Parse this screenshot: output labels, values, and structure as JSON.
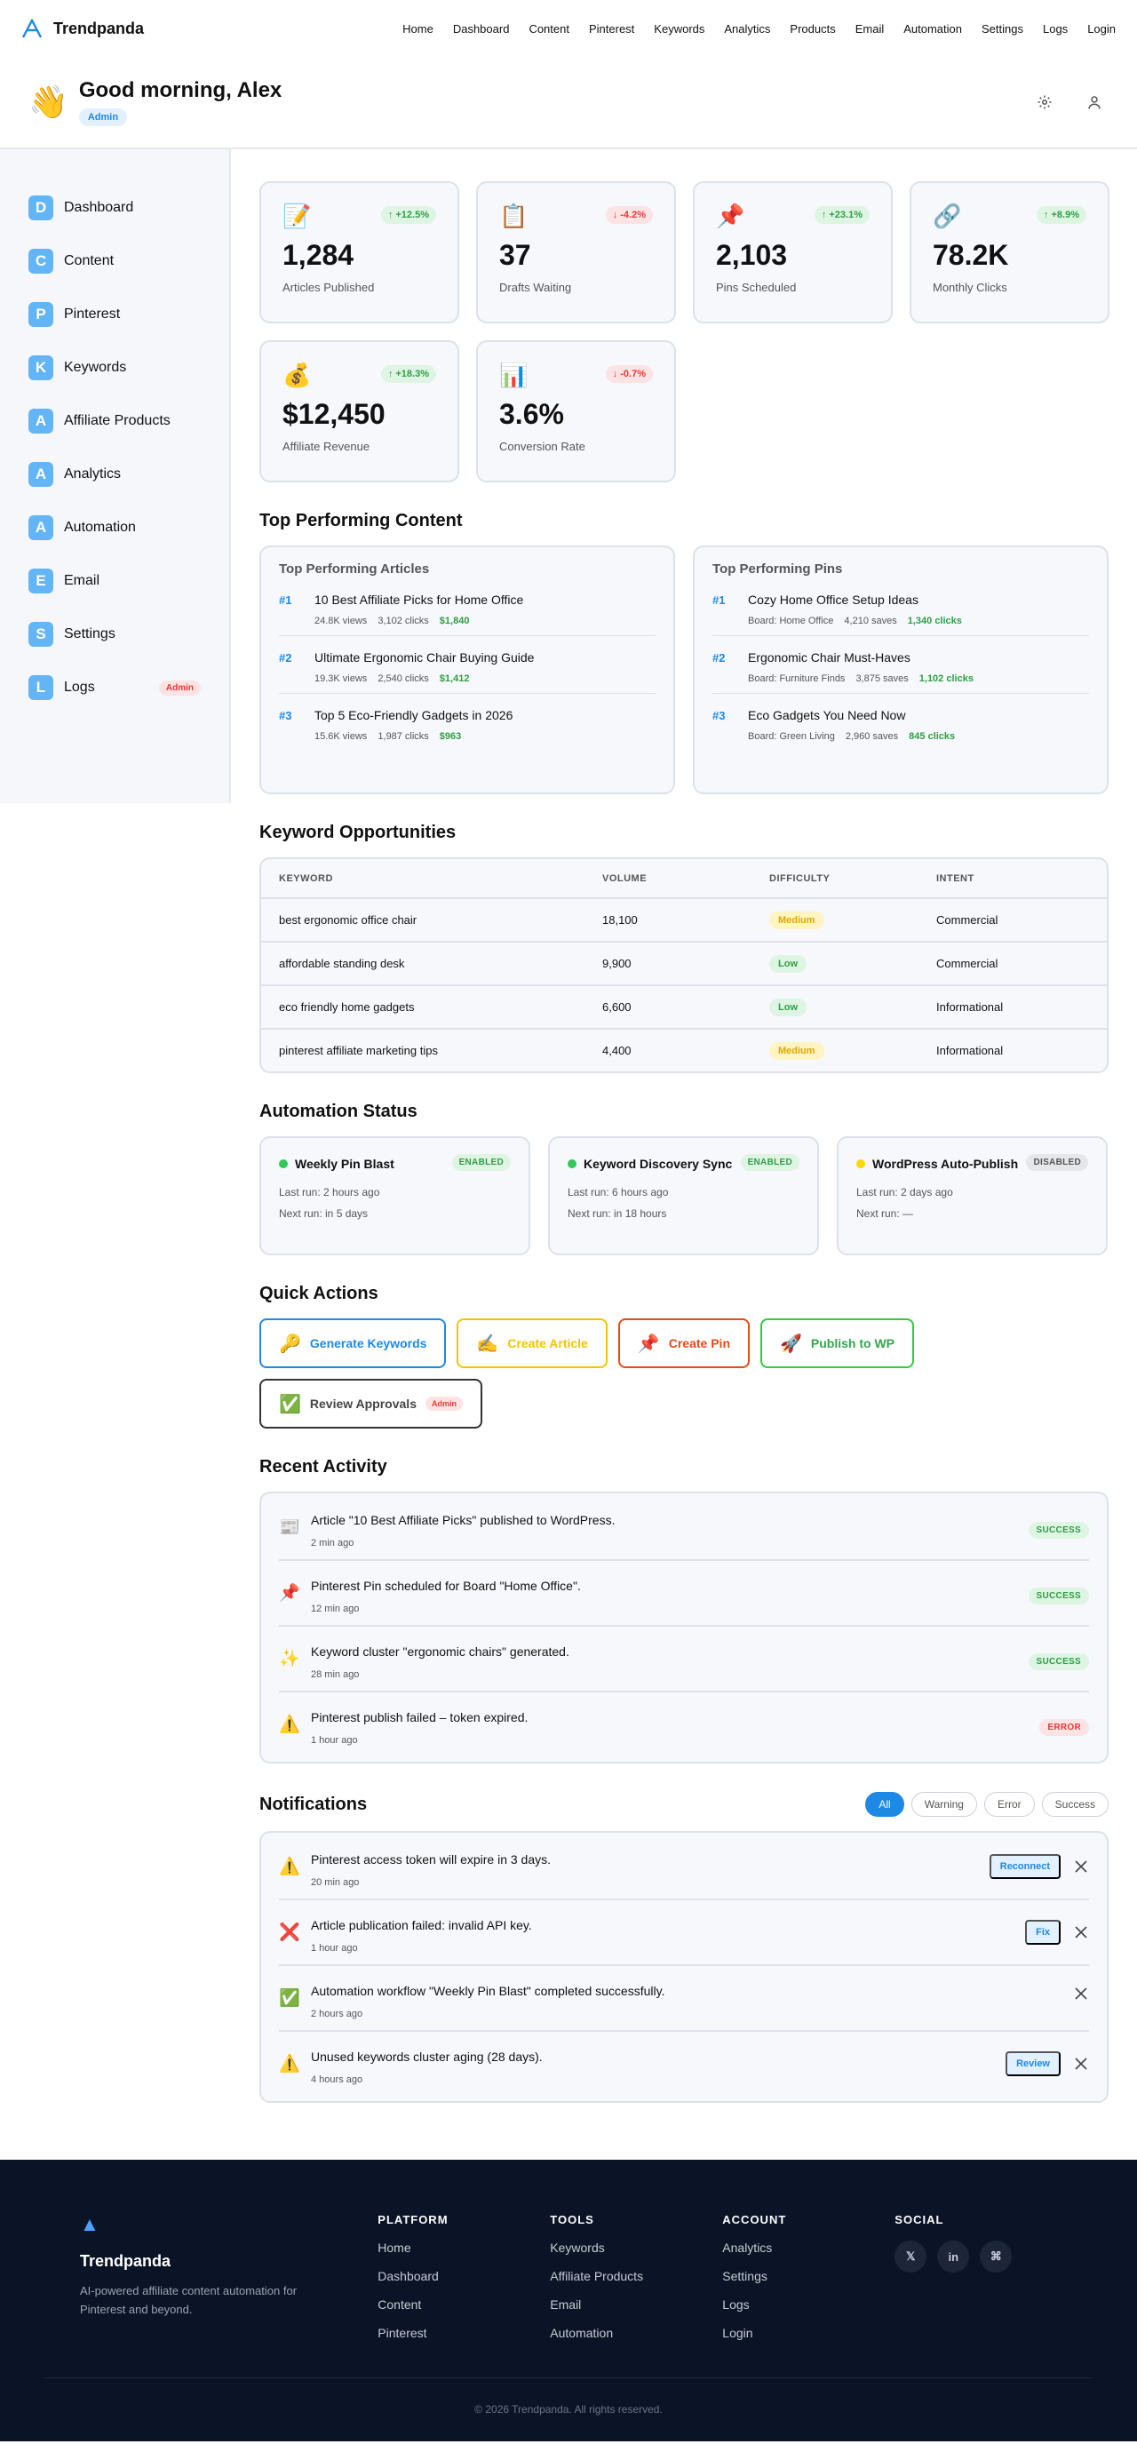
{
  "brand": {
    "name": "Trendpanda",
    "accent": "#1e88e5"
  },
  "nav": [
    "Home",
    "Dashboard",
    "Content",
    "Pinterest",
    "Keywords",
    "Analytics",
    "Products",
    "Email",
    "Automation",
    "Settings",
    "Logs",
    "Login"
  ],
  "greeting": {
    "emoji": "👋",
    "title": "Good morning, Alex",
    "role": "Admin"
  },
  "sidebar": [
    {
      "letter": "D",
      "label": "Dashboard"
    },
    {
      "letter": "C",
      "label": "Content"
    },
    {
      "letter": "P",
      "label": "Pinterest"
    },
    {
      "letter": "K",
      "label": "Keywords"
    },
    {
      "letter": "A",
      "label": "Affiliate Products"
    },
    {
      "letter": "A",
      "label": "Analytics"
    },
    {
      "letter": "A",
      "label": "Automation"
    },
    {
      "letter": "E",
      "label": "Email"
    },
    {
      "letter": "S",
      "label": "Settings"
    },
    {
      "letter": "L",
      "label": "Logs",
      "badge": "Admin"
    }
  ],
  "stats": [
    {
      "icon": "📝",
      "delta": "↑ +12.5%",
      "dir": "up",
      "value": "1,284",
      "label": "Articles Published"
    },
    {
      "icon": "📋",
      "delta": "↓ -4.2%",
      "dir": "down",
      "value": "37",
      "label": "Drafts Waiting"
    },
    {
      "icon": "📌",
      "delta": "↑ +23.1%",
      "dir": "up",
      "value": "2,103",
      "label": "Pins Scheduled"
    },
    {
      "icon": "🔗",
      "delta": "↑ +8.9%",
      "dir": "up",
      "value": "78.2K",
      "label": "Monthly Clicks"
    },
    {
      "icon": "💰",
      "delta": "↑ +18.3%",
      "dir": "up",
      "value": "$12,450",
      "label": "Affiliate Revenue"
    },
    {
      "icon": "📊",
      "delta": "↓ -0.7%",
      "dir": "down",
      "value": "3.6%",
      "label": "Conversion Rate"
    }
  ],
  "top_content": {
    "title": "Top Performing Content",
    "articles": {
      "title": "Top Performing Articles",
      "items": [
        {
          "rank": "#1",
          "title": "10 Best Affiliate Picks for Home Office",
          "m1": "24.8K views",
          "m2": "3,102 clicks",
          "m3": "$1,840"
        },
        {
          "rank": "#2",
          "title": "Ultimate Ergonomic Chair Buying Guide",
          "m1": "19.3K views",
          "m2": "2,540 clicks",
          "m3": "$1,412"
        },
        {
          "rank": "#3",
          "title": "Top 5 Eco-Friendly Gadgets in 2026",
          "m1": "15.6K views",
          "m2": "1,987 clicks",
          "m3": "$963"
        }
      ]
    },
    "pins": {
      "title": "Top Performing Pins",
      "items": [
        {
          "rank": "#1",
          "title": "Cozy Home Office Setup Ideas",
          "m1": "Board: Home Office",
          "m2": "4,210 saves",
          "m3": "1,340 clicks"
        },
        {
          "rank": "#2",
          "title": "Ergonomic Chair Must-Haves",
          "m1": "Board: Furniture Finds",
          "m2": "3,875 saves",
          "m3": "1,102 clicks"
        },
        {
          "rank": "#3",
          "title": "Eco Gadgets You Need Now",
          "m1": "Board: Green Living",
          "m2": "2,960 saves",
          "m3": "845 clicks"
        }
      ]
    }
  },
  "keywords": {
    "title": "Keyword Opportunities",
    "headers": [
      "KEYWORD",
      "VOLUME",
      "DIFFICULTY",
      "INTENT"
    ],
    "rows": [
      {
        "keyword": "best ergonomic office chair",
        "volume": "18,100",
        "difficulty": "Medium",
        "intent": "Commercial"
      },
      {
        "keyword": "affordable standing desk",
        "volume": "9,900",
        "difficulty": "Low",
        "intent": "Commercial"
      },
      {
        "keyword": "eco friendly home gadgets",
        "volume": "6,600",
        "difficulty": "Low",
        "intent": "Informational"
      },
      {
        "keyword": "pinterest affiliate marketing tips",
        "volume": "4,400",
        "difficulty": "Medium",
        "intent": "Informational"
      }
    ]
  },
  "automation": {
    "title": "Automation Status",
    "items": [
      {
        "name": "Weekly Pin Blast",
        "status": "ENABLED",
        "last": "Last run: 2 hours ago",
        "next": "Next run: in 5 days",
        "dot": "green"
      },
      {
        "name": "Keyword Discovery Sync",
        "status": "ENABLED",
        "last": "Last run: 6 hours ago",
        "next": "Next run: in 18 hours",
        "dot": "green"
      },
      {
        "name": "WordPress Auto-Publish",
        "status": "DISABLED",
        "last": "Last run: 2 days ago",
        "next": "Next run: —",
        "dot": "yellow"
      }
    ]
  },
  "quick_actions": {
    "title": "Quick Actions",
    "items": [
      {
        "emoji": "🔑",
        "label": "Generate Keywords",
        "style": "blue"
      },
      {
        "emoji": "✍️",
        "label": "Create Article",
        "style": "yellow"
      },
      {
        "emoji": "📌",
        "label": "Create Pin",
        "style": "red"
      },
      {
        "emoji": "🚀",
        "label": "Publish to WP",
        "style": "green"
      },
      {
        "emoji": "✅",
        "label": "Review Approvals",
        "style": "gray",
        "badge": "Admin"
      }
    ]
  },
  "activity": {
    "title": "Recent Activity",
    "items": [
      {
        "icon": "📰",
        "text": "Article \"10 Best Affiliate Picks\" published to WordPress.",
        "time": "2 min ago",
        "status": "SUCCESS"
      },
      {
        "icon": "📌",
        "text": "Pinterest Pin scheduled for Board \"Home Office\".",
        "time": "12 min ago",
        "status": "SUCCESS"
      },
      {
        "icon": "✨",
        "text": "Keyword cluster \"ergonomic chairs\" generated.",
        "time": "28 min ago",
        "status": "SUCCESS"
      },
      {
        "icon": "⚠️",
        "text": "Pinterest publish failed – token expired.",
        "time": "1 hour ago",
        "status": "ERROR"
      }
    ]
  },
  "notifications": {
    "title": "Notifications",
    "filters": [
      "All",
      "Warning",
      "Error",
      "Success"
    ],
    "items": [
      {
        "icon": "⚠️",
        "text": "Pinterest access token will expire in 3 days.",
        "time": "20 min ago",
        "action": "Reconnect"
      },
      {
        "icon": "❌",
        "text": "Article publication failed: invalid API key.",
        "time": "1 hour ago",
        "action": "Fix"
      },
      {
        "icon": "✅",
        "text": "Automation workflow \"Weekly Pin Blast\" completed successfully.",
        "time": "2 hours ago",
        "action": ""
      },
      {
        "icon": "⚠️",
        "text": "Unused keywords cluster aging (28 days).",
        "time": "4 hours ago",
        "action": "Review"
      }
    ]
  },
  "footer": {
    "logo": "▲",
    "name": "Trendpanda",
    "tagline": "AI-powered affiliate content automation for Pinterest and beyond.",
    "columns": [
      {
        "head": "PLATFORM",
        "links": [
          "Home",
          "Dashboard",
          "Content",
          "Pinterest"
        ]
      },
      {
        "head": "TOOLS",
        "links": [
          "Keywords",
          "Affiliate Products",
          "Email",
          "Automation"
        ]
      },
      {
        "head": "ACCOUNT",
        "links": [
          "Analytics",
          "Settings",
          "Logs",
          "Login"
        ]
      }
    ],
    "social_head": "SOCIAL",
    "social": [
      "𝕏",
      "in",
      "⌘"
    ],
    "copyright": "© 2026 Trendpanda. All rights reserved."
  }
}
